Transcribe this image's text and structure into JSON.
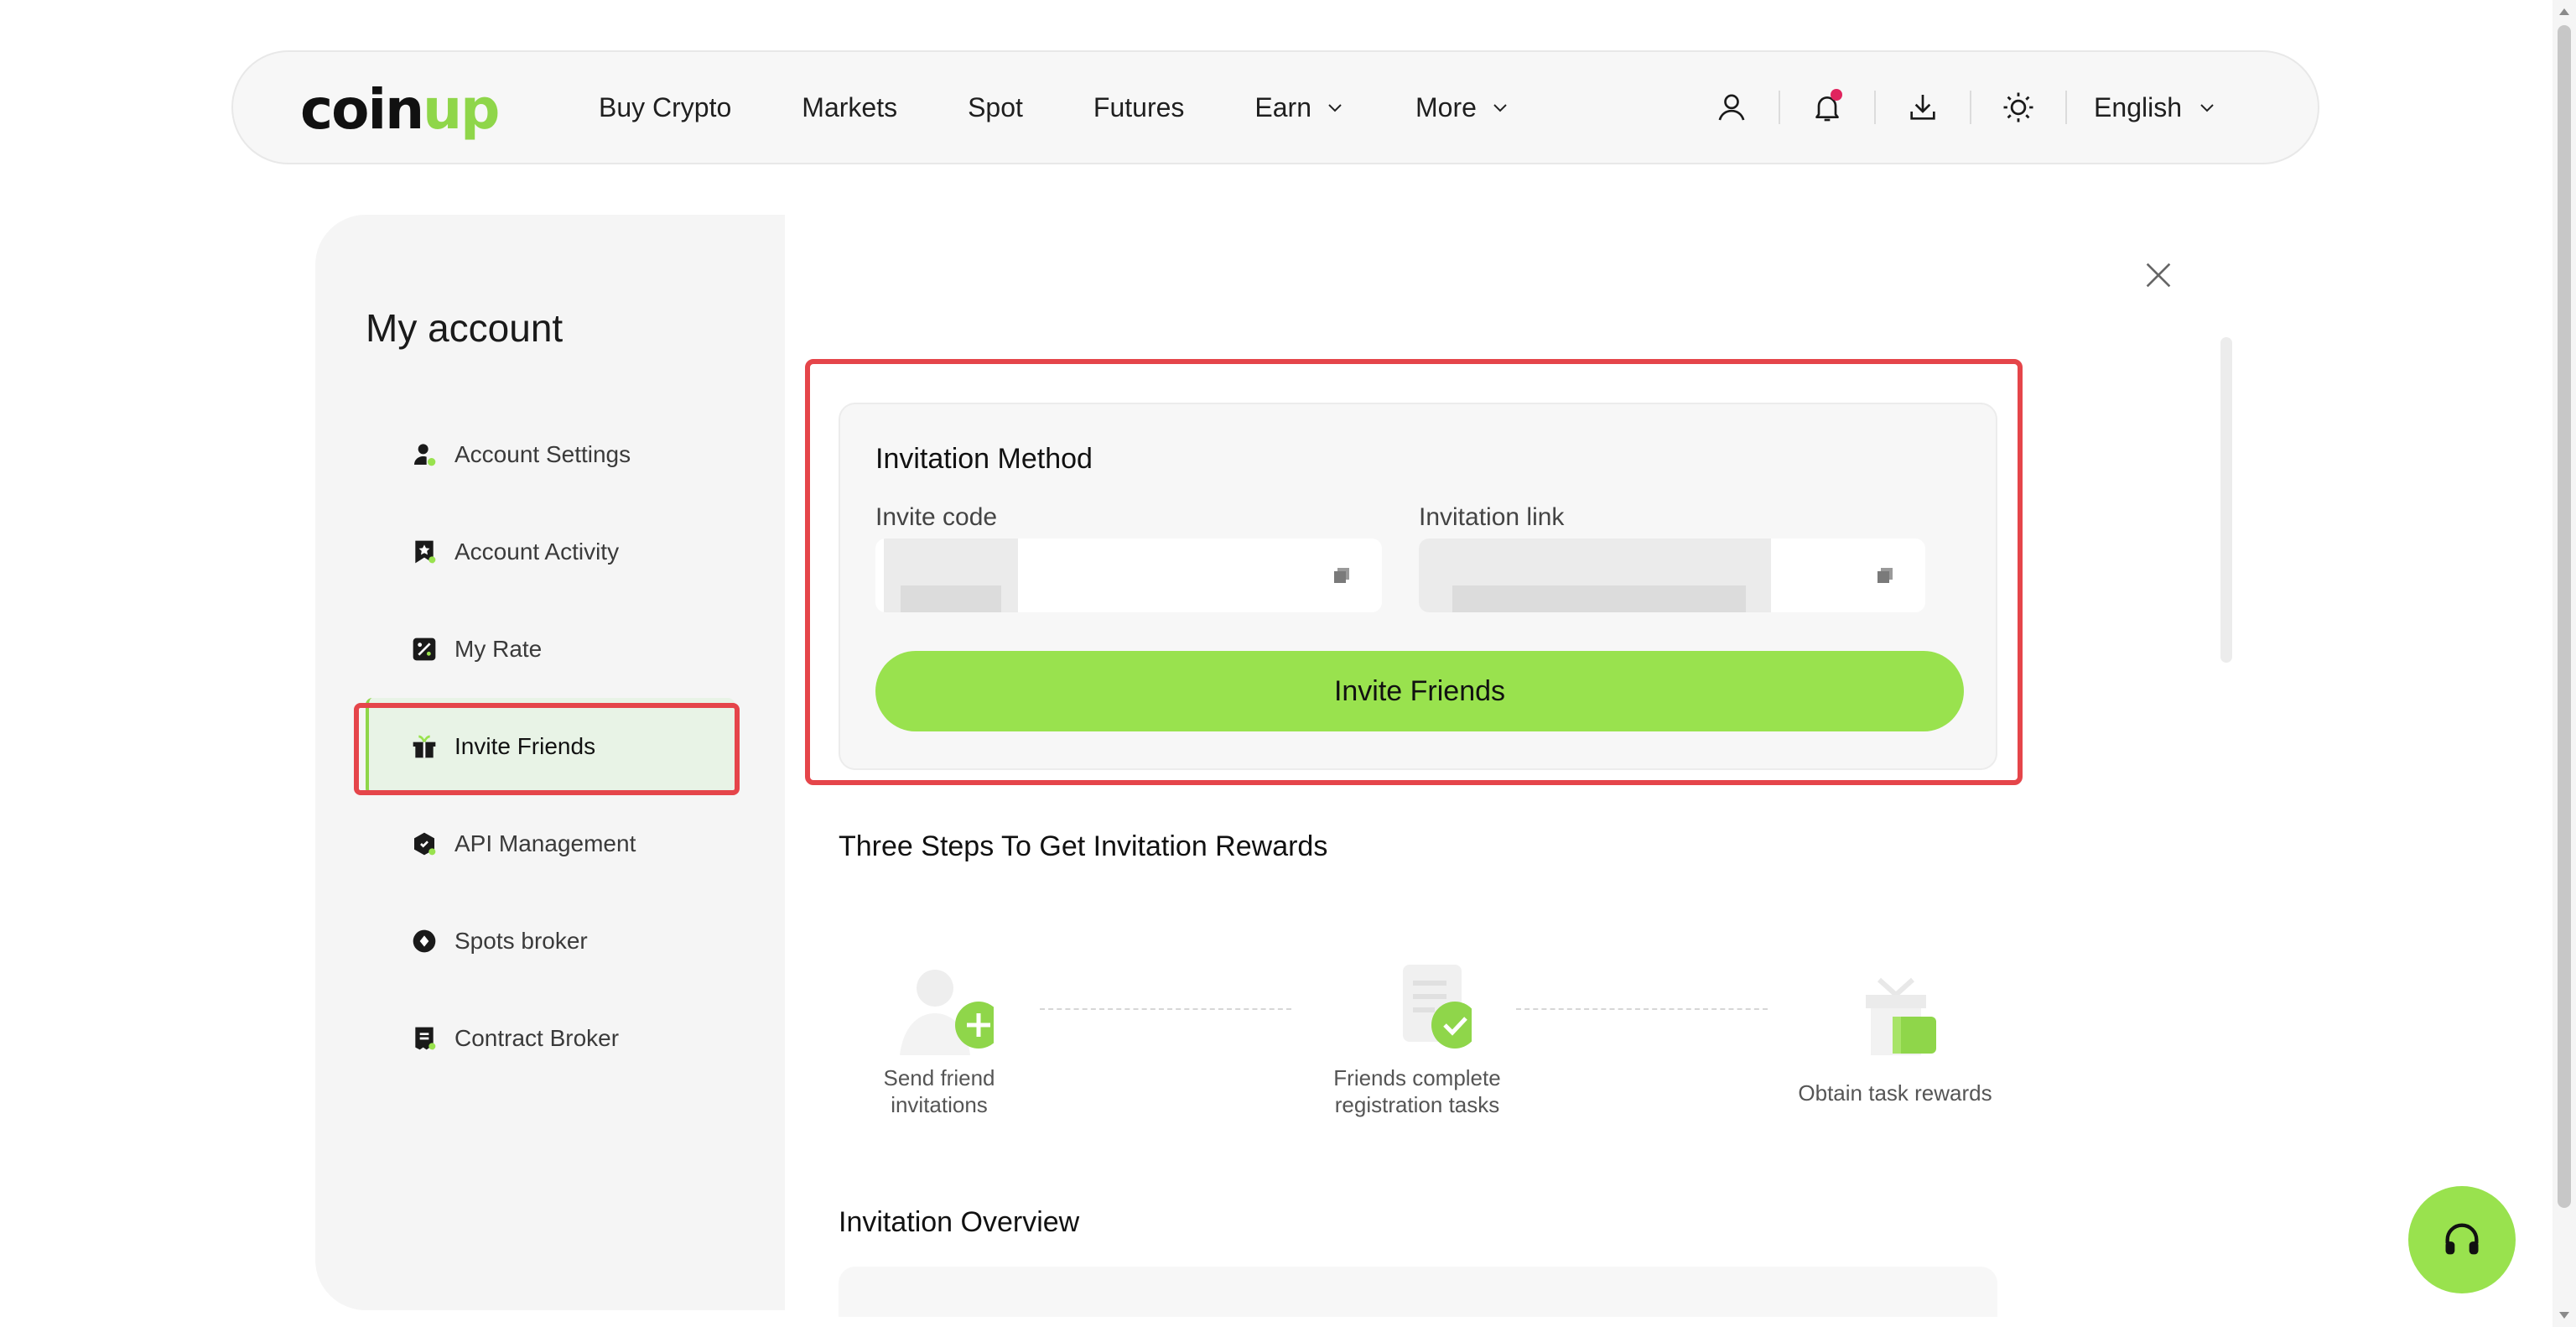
{
  "brand": {
    "logo_main": "coin",
    "logo_accent": "up",
    "accent_color": "#99e24e"
  },
  "nav": {
    "items": [
      {
        "label": "Buy Crypto"
      },
      {
        "label": "Markets"
      },
      {
        "label": "Spot"
      },
      {
        "label": "Futures"
      },
      {
        "label": "Earn"
      },
      {
        "label": "More"
      }
    ],
    "icons": [
      "user-icon",
      "bell-icon",
      "download-icon",
      "theme-sun-icon"
    ],
    "language": "English"
  },
  "sidebar": {
    "title": "My account",
    "items": [
      {
        "label": "Account Settings",
        "icon": "user-settings-icon"
      },
      {
        "label": "Account Activity",
        "icon": "star-bookmark-icon"
      },
      {
        "label": "My Rate",
        "icon": "percent-icon"
      },
      {
        "label": "Invite Friends",
        "icon": "gift-icon",
        "active": true
      },
      {
        "label": "API Management",
        "icon": "api-hexagon-icon"
      },
      {
        "label": "Spots broker",
        "icon": "spot-circle-icon"
      },
      {
        "label": "Contract Broker",
        "icon": "contract-doc-icon"
      }
    ]
  },
  "invite": {
    "title": "Invitation Method",
    "code_label": "Invite code",
    "link_label": "Invitation link",
    "button": "Invite Friends"
  },
  "steps": {
    "title": "Three Steps To Get Invitation Rewards",
    "items": [
      {
        "line1": "Send friend",
        "line2": "invitations"
      },
      {
        "line1": "Friends complete",
        "line2": "registration tasks"
      },
      {
        "line1": "Obtain task rewards",
        "line2": ""
      }
    ]
  },
  "overview": {
    "title": "Invitation Overview"
  }
}
